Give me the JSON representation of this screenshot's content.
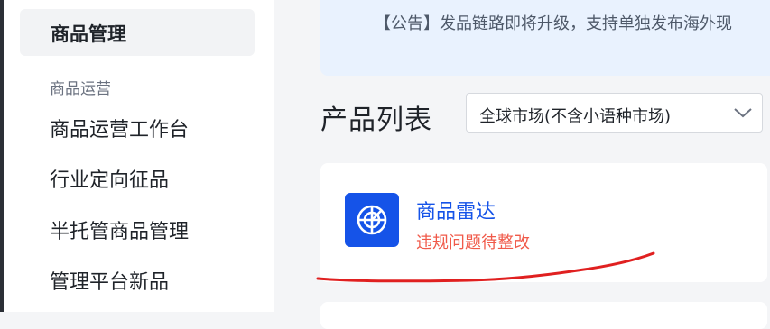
{
  "sidebar": {
    "active_item": "商品管理",
    "section_label": "商品运营",
    "items": [
      {
        "label": "商品运营工作台"
      },
      {
        "label": "行业定向征品"
      },
      {
        "label": "半托管商品管理"
      },
      {
        "label": "管理平台新品"
      }
    ]
  },
  "notice": {
    "text": "【公告】发品链路即将升级，支持单独发布海外现"
  },
  "page": {
    "title": "产品列表"
  },
  "market_select": {
    "value": "全球市场(不含小语种市场)",
    "icon": "chevron-down-icon"
  },
  "tool_card": {
    "title": "商品雷达",
    "status": "违规问题待整改",
    "icon": "radar-icon",
    "icon_bg": "#1553e8",
    "status_color": "#f05a4a"
  },
  "colors": {
    "accent": "#1553e8",
    "annotation": "#e02020"
  }
}
